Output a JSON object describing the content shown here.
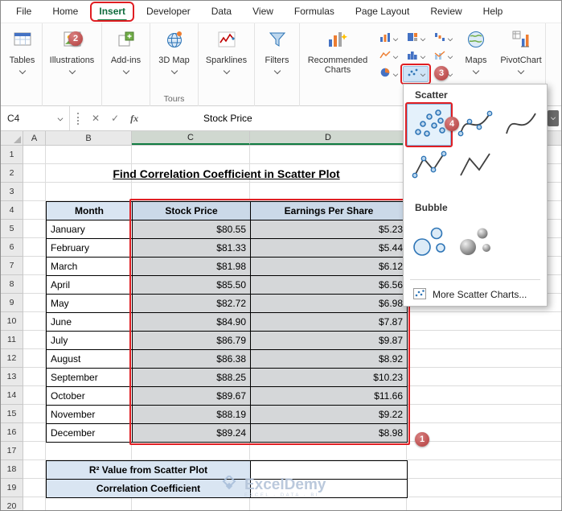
{
  "ribbon": {
    "tabs": [
      "File",
      "Home",
      "Insert",
      "Developer",
      "Data",
      "View",
      "Formulas",
      "Page Layout",
      "Review",
      "Help"
    ],
    "selected_tab": "Insert",
    "buttons": {
      "tables": "Tables",
      "illustrations": "Illustrations",
      "addins": "Add-ins",
      "map3d": "3D Map",
      "sparklines": "Sparklines",
      "filters": "Filters",
      "recommended_charts": "Recommended Charts",
      "maps": "Maps",
      "pivotchart": "PivotChart"
    },
    "group_labels": {
      "tours": "Tours"
    }
  },
  "formula_bar": {
    "name_box": "C4",
    "cancel_icon": "✕",
    "enter_icon": "✓",
    "fx_icon": "fx",
    "content": "Stock Price"
  },
  "scatter_menu": {
    "scatter_section": "Scatter",
    "bubble_section": "Bubble",
    "more_item": "More Scatter Charts..."
  },
  "sheet": {
    "column_headers": [
      "A",
      "B",
      "C",
      "D"
    ],
    "selected_columns": [
      "C",
      "D"
    ],
    "visible_rows": 20,
    "title": "Find Correlation Coefficient in Scatter Plot",
    "table": {
      "headers": [
        "Month",
        "Stock Price",
        "Earnings Per Share"
      ],
      "rows": [
        [
          "January",
          "$80.55",
          "$5.23"
        ],
        [
          "February",
          "$81.33",
          "$5.44"
        ],
        [
          "March",
          "$81.98",
          "$6.12"
        ],
        [
          "April",
          "$85.50",
          "$6.56"
        ],
        [
          "May",
          "$82.72",
          "$6.98"
        ],
        [
          "June",
          "$84.90",
          "$7.87"
        ],
        [
          "July",
          "$86.79",
          "$9.87"
        ],
        [
          "August",
          "$86.38",
          "$8.92"
        ],
        [
          "September",
          "$88.25",
          "$10.23"
        ],
        [
          "October",
          "$89.67",
          "$11.66"
        ],
        [
          "November",
          "$88.19",
          "$9.22"
        ],
        [
          "December",
          "$89.24",
          "$8.98"
        ]
      ]
    },
    "summary": {
      "r2_label": "R² Value from Scatter Plot",
      "corr_label": "Correlation Coefficient"
    }
  },
  "annotations": {
    "steps": [
      "1",
      "2",
      "3",
      "4"
    ]
  },
  "watermark": {
    "brand": "ExcelDemy",
    "tagline": "EXCEL · DATA · BI"
  },
  "colors": {
    "annotation_red": "#e01e23",
    "step_circle": "#b23c3c",
    "excel_green": "#107c41",
    "header_fill": "#d9e5f2",
    "selection_fill": "#d5d7d9"
  }
}
